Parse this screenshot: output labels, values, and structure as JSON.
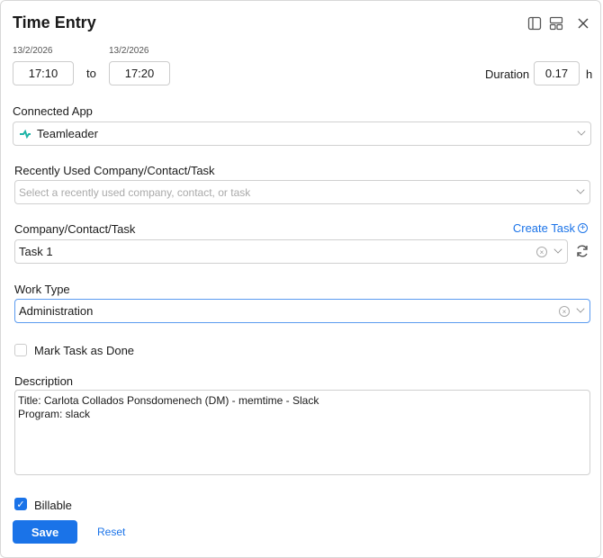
{
  "header": {
    "title": "Time Entry",
    "icons": [
      "sidebar-layout-icon",
      "grid-layout-icon",
      "close-icon"
    ]
  },
  "time": {
    "start_date": "13/2/2026",
    "end_date": "13/2/2026",
    "start_time": "17:10",
    "to_label": "to",
    "end_time": "17:20",
    "duration_label": "Duration",
    "duration": "0.17",
    "duration_unit": "h"
  },
  "connected_app": {
    "label": "Connected App",
    "value": "Teamleader"
  },
  "recent": {
    "label": "Recently Used Company/Contact/Task",
    "placeholder": "Select a recently used company, contact, or task"
  },
  "company": {
    "label": "Company/Contact/Task",
    "create_task": "Create Task",
    "value": "Task 1"
  },
  "work_type": {
    "label": "Work Type",
    "value": "Administration"
  },
  "mark_done": {
    "label": "Mark Task as Done",
    "checked": false
  },
  "description": {
    "label": "Description",
    "line1": "Title: Carlota Collados Ponsdomenech (DM) - memtime - Slack",
    "line2": "Program: slack"
  },
  "billable": {
    "label": "Billable",
    "checked": true
  },
  "actions": {
    "save": "Save",
    "reset": "Reset"
  },
  "colors": {
    "accent": "#1a73e8",
    "teamleader": "#1fb5a8"
  }
}
